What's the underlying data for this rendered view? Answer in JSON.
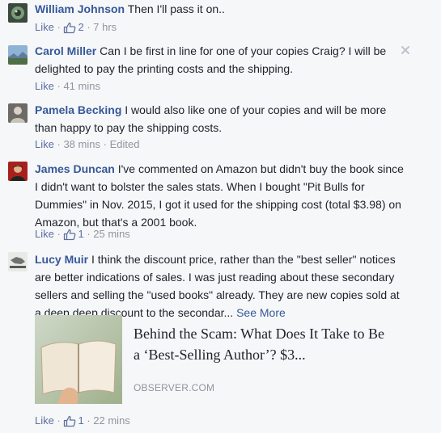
{
  "comments": [
    {
      "author": "William Johnson",
      "text": "Then I'll pass it on..",
      "like_label": "Like",
      "reactions": "2",
      "time": "7 hrs"
    },
    {
      "author": "Carol Miller",
      "text": "Can I be first in line for one of your copies Craig? I will be delighted to pay the printing costs and the shipping.",
      "like_label": "Like",
      "time": "41 mins"
    },
    {
      "author": "Pamela Becking",
      "text": "I would also like one of your copies and will be more than happy to pay the shipping costs.",
      "like_label": "Like",
      "time": "38 mins",
      "edited": "Edited"
    },
    {
      "author": "James Duncan",
      "text": "I've commented on Amazon but didn't buy the book since I didn't want to bolster the sales stats. When I bought \"Pit Bulls for Dummies\" in Nov. 2015, I got it used for the shipping cost (total $3.98) on Amazon, but that's a 2001 book.",
      "like_label": "Like",
      "reactions": "1",
      "time": "25 mins"
    },
    {
      "author": "Lucy Muir",
      "text": "I think the discount price, rather than the \"best seller\" notices are better indications of sales. I was just reading about these secondary sellers and selling the \"used books\" already. They are new copies sold at a deep deep discount to the secondar...",
      "see_more": "See More",
      "like_label": "Like",
      "reactions": "1",
      "time": "22 mins",
      "link": {
        "title": "Behind the Scam: What Does It Take to Be a ‘Best-Selling Author’? $3...",
        "domain": "OBSERVER.COM"
      }
    }
  ],
  "separator": "·",
  "icons": {
    "like_reaction": "thumbs-up-outline-icon",
    "close": "close-x-icon"
  },
  "colors": {
    "author": "#365899",
    "meta": "#90949c",
    "background": "#f6f7f9"
  }
}
